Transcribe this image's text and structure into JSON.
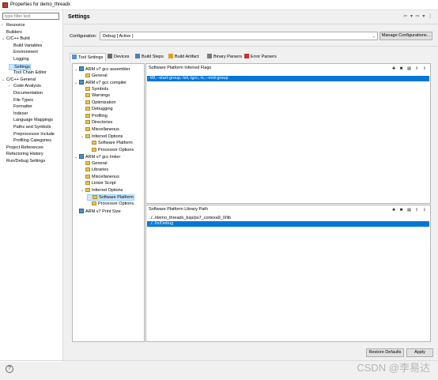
{
  "window": {
    "title": "Properties for demo_threadx"
  },
  "filter": {
    "placeholder": "type filter text"
  },
  "left_tree": {
    "items": [
      {
        "label": "Resource",
        "arrow": "›"
      },
      {
        "label": "Builders",
        "arrow": ""
      },
      {
        "label": "C/C++ Build",
        "arrow": "⌄"
      },
      {
        "label": "Build Variables",
        "arrow": ""
      },
      {
        "label": "Environment",
        "arrow": ""
      },
      {
        "label": "Logging",
        "arrow": ""
      },
      {
        "label": "Settings",
        "arrow": ""
      },
      {
        "label": "Tool Chain Editor",
        "arrow": ""
      },
      {
        "label": "C/C++ General",
        "arrow": "⌄"
      },
      {
        "label": "Code Analysis",
        "arrow": "›"
      },
      {
        "label": "Documentation",
        "arrow": ""
      },
      {
        "label": "File Types",
        "arrow": ""
      },
      {
        "label": "Formatter",
        "arrow": ""
      },
      {
        "label": "Indexer",
        "arrow": ""
      },
      {
        "label": "Language Mappings",
        "arrow": ""
      },
      {
        "label": "Paths and Symbols",
        "arrow": ""
      },
      {
        "label": "Preprocessor Include",
        "arrow": ""
      },
      {
        "label": "Profiling Categories",
        "arrow": ""
      },
      {
        "label": "Project References",
        "arrow": ""
      },
      {
        "label": "Refactoring History",
        "arrow": ""
      },
      {
        "label": "Run/Debug Settings",
        "arrow": ""
      }
    ]
  },
  "header": {
    "title": "Settings",
    "nav_icons": "⇦ ▾ ⇨ ▾ ⋮"
  },
  "configuration": {
    "label": "Configuration:",
    "value": "Debug  [ Active ]",
    "manage_button": "Manage Configurations..."
  },
  "tabs": [
    {
      "label": "Tool Settings",
      "icon_color": "#5a8fd0"
    },
    {
      "label": "Devices",
      "icon_color": "#6b6b6b"
    },
    {
      "label": "Build Steps",
      "icon_color": "#4a7fb5"
    },
    {
      "label": "Build Artifact",
      "icon_color": "#e0a020"
    },
    {
      "label": "Binary Parsers",
      "icon_color": "#7a7a7a"
    },
    {
      "label": "Error Parsers",
      "icon_color": "#d03030"
    }
  ],
  "tool_tree": {
    "items": [
      {
        "label": "ARM v7 gcc assembler",
        "arrow": "⌄",
        "icon": "chip"
      },
      {
        "label": "General",
        "arrow": "",
        "icon": "folder"
      },
      {
        "label": "ARM v7 gcc compiler",
        "arrow": "⌄",
        "icon": "chip"
      },
      {
        "label": "Symbols",
        "arrow": "",
        "icon": "folder"
      },
      {
        "label": "Warnings",
        "arrow": "",
        "icon": "folder"
      },
      {
        "label": "Optimization",
        "arrow": "",
        "icon": "folder"
      },
      {
        "label": "Debugging",
        "arrow": "",
        "icon": "folder"
      },
      {
        "label": "Profiling",
        "arrow": "",
        "icon": "folder"
      },
      {
        "label": "Directories",
        "arrow": "",
        "icon": "folder"
      },
      {
        "label": "Miscellaneous",
        "arrow": "",
        "icon": "folder"
      },
      {
        "label": "Inferred Options",
        "arrow": "⌄",
        "icon": "folder"
      },
      {
        "label": "Software Platform",
        "arrow": "",
        "icon": "folder"
      },
      {
        "label": "Processor Options",
        "arrow": "",
        "icon": "folder"
      },
      {
        "label": "ARM v7 gcc linker",
        "arrow": "⌄",
        "icon": "chip"
      },
      {
        "label": "General",
        "arrow": "",
        "icon": "folder"
      },
      {
        "label": "Libraries",
        "arrow": "",
        "icon": "folder"
      },
      {
        "label": "Miscellaneous",
        "arrow": "",
        "icon": "folder"
      },
      {
        "label": "Linker Script",
        "arrow": "",
        "icon": "folder"
      },
      {
        "label": "Inferred Options",
        "arrow": "⌄",
        "icon": "folder"
      },
      {
        "label": "Software Platform",
        "arrow": "",
        "icon": "folder"
      },
      {
        "label": "Processor Options",
        "arrow": "",
        "icon": "folder"
      },
      {
        "label": "ARM v7 Print Size",
        "arrow": "",
        "icon": "chip"
      }
    ]
  },
  "flags_panel": {
    "title": "Software Platform Inferred Flags",
    "icons": "✚ ✖ ▤ ⇧ ⇩",
    "rows": [
      "-Wl,--start-group,-lxil,-lgcc,-lc,--end-group"
    ]
  },
  "libpath_panel": {
    "title": "Software Platform Library Path",
    "icons": "✚ ✖ ▤ ⇧ ⇩",
    "rows": [
      "../../demo_threadx_bsp/ps7_cortexa9_0/lib",
      "../../tx/Debug"
    ]
  },
  "footer": {
    "restore_button": "Restore Defaults",
    "apply_button": "Apply",
    "help_icon": "?"
  },
  "watermark": {
    "text": "CSDN @李易达"
  }
}
